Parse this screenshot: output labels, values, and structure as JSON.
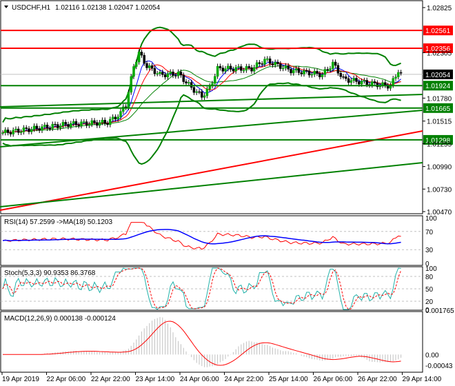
{
  "header": {
    "symbol": "USDCHF,H1",
    "ohlc": "1.02116 1.02138 1.02047 1.02054"
  },
  "price_axis": {
    "ticks": [
      "1.02825",
      "1.02305",
      "1.01780",
      "1.01515",
      "1.01255",
      "1.00990",
      "1.00730",
      "1.00470"
    ],
    "tick_values": [
      1.02825,
      1.02305,
      1.0178,
      1.01515,
      1.01255,
      1.0099,
      1.0073,
      1.0047
    ]
  },
  "levels": [
    {
      "label": "1.02561",
      "value": 1.02561,
      "color": "#ff0000"
    },
    {
      "label": "1.02356",
      "value": 1.02356,
      "color": "#ff0000"
    },
    {
      "label": "1.01924",
      "value": 1.01924,
      "color": "#008000"
    },
    {
      "label": "1.01665",
      "value": 1.01665,
      "color": "#008000"
    },
    {
      "label": "1.01298",
      "value": 1.01298,
      "color": "#008000"
    }
  ],
  "current_price": {
    "label": "1.02054",
    "value": 1.02054
  },
  "price_path": [
    [
      0,
      1.0138
    ],
    [
      10,
      1.0142
    ],
    [
      25,
      1.0148
    ],
    [
      40,
      1.015
    ],
    [
      45,
      1.016
    ],
    [
      43,
      1.0158
    ],
    [
      47,
      1.017
    ],
    [
      50,
      1.0215
    ],
    [
      52,
      1.023
    ],
    [
      55,
      1.0215
    ],
    [
      60,
      1.0205
    ],
    [
      67,
      1.0206
    ],
    [
      72,
      1.019
    ],
    [
      76,
      1.018
    ],
    [
      79,
      1.019
    ],
    [
      82,
      1.0212
    ],
    [
      95,
      1.0212
    ],
    [
      100,
      1.0222
    ],
    [
      110,
      1.021
    ],
    [
      122,
      1.0205
    ],
    [
      126,
      1.0218
    ],
    [
      130,
      1.02
    ],
    [
      140,
      1.0195
    ],
    [
      145,
      1.0193
    ],
    [
      148,
      1.0192
    ],
    [
      151,
      1.021
    ],
    [
      152,
      1.0205
    ]
  ],
  "rsi": {
    "label": "RSI(14) 57.2599  ->MA(18) 50.1203",
    "ticks": [
      "100",
      "70",
      "30",
      "0"
    ]
  },
  "stoch": {
    "label": "Stoch(5,3,3) 90.9353 86.3768",
    "ticks": [
      "100",
      "80",
      "50",
      "20",
      "0"
    ]
  },
  "macd": {
    "label": "MACD(12,26,9) 0.000138 -0.000124",
    "ticks": [
      "0.001765",
      "0.00",
      "-0.00043"
    ]
  },
  "time_axis": [
    "19 Apr 2019",
    "22 Apr 06:00",
    "22 Apr 22:00",
    "23 Apr 14:00",
    "24 Apr 06:00",
    "24 Apr 22:00",
    "25 Apr 14:00",
    "26 Apr 06:00",
    "26 Apr 22:00",
    "29 Apr 14:00"
  ],
  "colors": {
    "bull": "#00aa00",
    "bear": "#000000",
    "rsi": "#ff0000",
    "rsi_ma": "#0000ff",
    "stoch_main": "#20b2aa",
    "stoch_signal": "#ff0000",
    "macd_signal": "#ff0000",
    "macd_hist": "#c0c0c0"
  }
}
